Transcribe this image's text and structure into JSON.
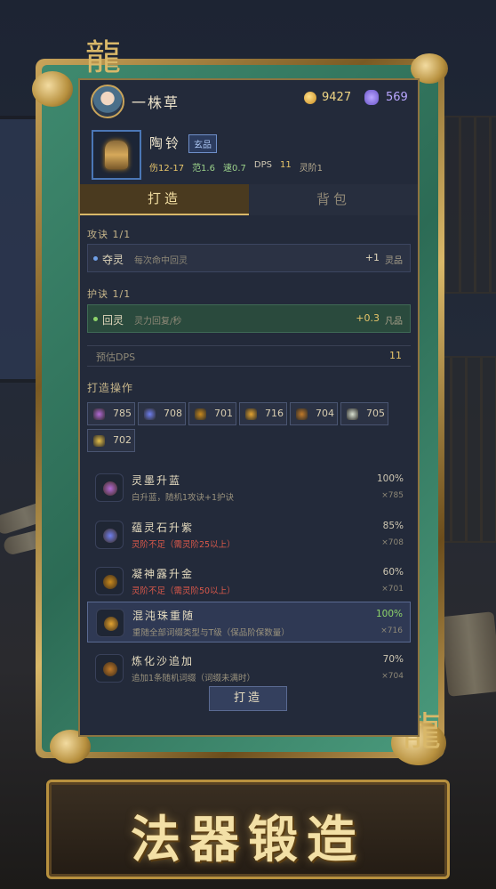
{
  "player": {
    "name": "一株草",
    "coins": "9427",
    "spirit": "569"
  },
  "item": {
    "name": "陶铃",
    "grade": "玄品",
    "stats": {
      "dmg": "伤12-17",
      "range": "范1.6",
      "speed": "速0.7",
      "dps_label": "DPS",
      "dps_value": "11",
      "tier": "灵阶1"
    }
  },
  "tabs": {
    "forge": "打造",
    "bag": "背包"
  },
  "attack": {
    "header": "攻诀 1/1",
    "name": "夺灵",
    "desc": "每次命中回灵",
    "value": "+1",
    "grade": "灵品"
  },
  "defense": {
    "header": "护诀 1/1",
    "name": "回灵",
    "desc": "灵力回复/秒",
    "value": "+0.3",
    "grade": "凡品"
  },
  "dps": {
    "label": "预估DPS",
    "value": "11"
  },
  "forge_ops_header": "打造操作",
  "materials": [
    {
      "count": "785",
      "color": "#b36ad6"
    },
    {
      "count": "708",
      "color": "#6f7ff0"
    },
    {
      "count": "701",
      "color": "#c98a1e"
    },
    {
      "count": "716",
      "color": "#e3a431"
    },
    {
      "count": "704",
      "color": "#c07a2a"
    },
    {
      "count": "705",
      "color": "#d8e0d0"
    },
    {
      "count": "702",
      "color": "#e6c04a"
    }
  ],
  "operations": [
    {
      "title": "灵墨升蓝",
      "desc": "白升蓝，随机1攻诀+1护诀",
      "desc_warn": false,
      "pct": "100%",
      "cost": "×785",
      "color": "#b36ad6",
      "selected": false
    },
    {
      "title": "蕴灵石升紫",
      "desc": "灵阶不足（需灵阶25以上）",
      "desc_warn": true,
      "pct": "85%",
      "cost": "×708",
      "color": "#6f7ff0",
      "selected": false
    },
    {
      "title": "凝神露升金",
      "desc": "灵阶不足（需灵阶50以上）",
      "desc_warn": true,
      "pct": "60%",
      "cost": "×701",
      "color": "#c98a1e",
      "selected": false
    },
    {
      "title": "混沌珠重随",
      "desc": "重随全部词缀类型与T级（保品阶保数量）",
      "desc_warn": false,
      "pct": "100%",
      "cost": "×716",
      "color": "#e3a431",
      "selected": true
    },
    {
      "title": "炼化沙追加",
      "desc": "追加1条随机词缀（词缀未满时）",
      "desc_warn": false,
      "pct": "70%",
      "cost": "×704",
      "color": "#c07a2a",
      "selected": false
    }
  ],
  "forge_button": "打造",
  "banner": "法器锻造",
  "colors": {
    "accent_gold": "#d9b869",
    "frame_jade": "#3f8a6f",
    "warn_red": "#d8584a",
    "spirit_purple": "#b9a6ff"
  }
}
